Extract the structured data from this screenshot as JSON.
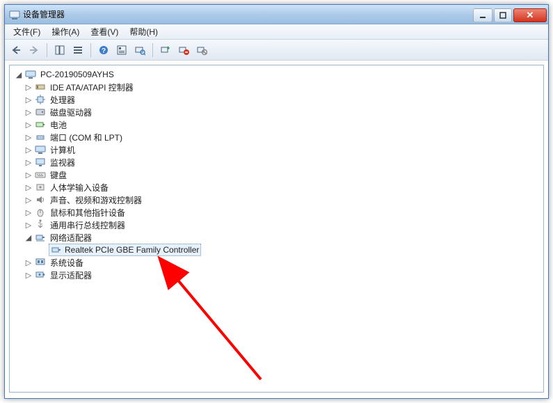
{
  "window": {
    "title": "设备管理器"
  },
  "menu": {
    "file": "文件(F)",
    "action": "操作(A)",
    "view": "查看(V)",
    "help": "帮助(H)"
  },
  "tree": {
    "root": "PC-20190509AYHS",
    "ide": "IDE ATA/ATAPI 控制器",
    "cpu": "处理器",
    "disk": "磁盘驱动器",
    "battery": "电池",
    "ports": "端口 (COM 和 LPT)",
    "computer": "计算机",
    "monitor": "监视器",
    "keyboard": "键盘",
    "hid": "人体学输入设备",
    "sound": "声音、视频和游戏控制器",
    "mouse": "鼠标和其他指针设备",
    "usb": "通用串行总线控制器",
    "network": "网络适配器",
    "network_child": "Realtek PCIe GBE Family Controller",
    "system": "系统设备",
    "display": "显示适配器"
  }
}
